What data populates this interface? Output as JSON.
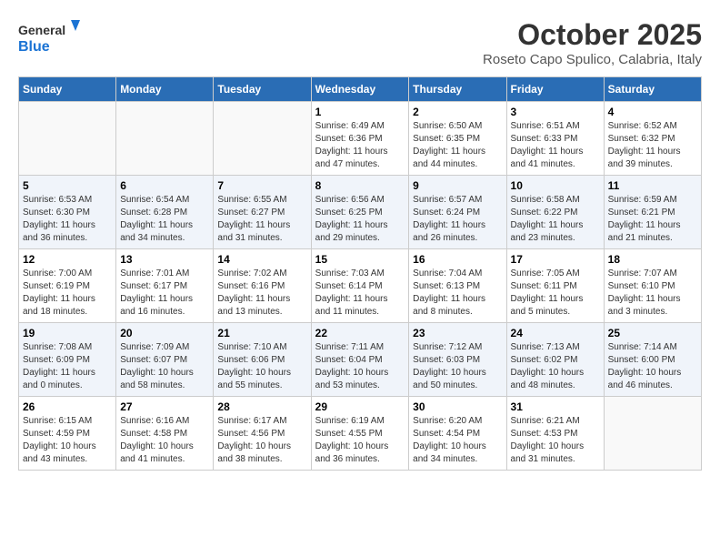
{
  "header": {
    "logo_line1": "General",
    "logo_line2": "Blue",
    "month": "October 2025",
    "location": "Roseto Capo Spulico, Calabria, Italy"
  },
  "days_of_week": [
    "Sunday",
    "Monday",
    "Tuesday",
    "Wednesday",
    "Thursday",
    "Friday",
    "Saturday"
  ],
  "weeks": [
    [
      {
        "day": "",
        "info": ""
      },
      {
        "day": "",
        "info": ""
      },
      {
        "day": "",
        "info": ""
      },
      {
        "day": "1",
        "info": "Sunrise: 6:49 AM\nSunset: 6:36 PM\nDaylight: 11 hours\nand 47 minutes."
      },
      {
        "day": "2",
        "info": "Sunrise: 6:50 AM\nSunset: 6:35 PM\nDaylight: 11 hours\nand 44 minutes."
      },
      {
        "day": "3",
        "info": "Sunrise: 6:51 AM\nSunset: 6:33 PM\nDaylight: 11 hours\nand 41 minutes."
      },
      {
        "day": "4",
        "info": "Sunrise: 6:52 AM\nSunset: 6:32 PM\nDaylight: 11 hours\nand 39 minutes."
      }
    ],
    [
      {
        "day": "5",
        "info": "Sunrise: 6:53 AM\nSunset: 6:30 PM\nDaylight: 11 hours\nand 36 minutes."
      },
      {
        "day": "6",
        "info": "Sunrise: 6:54 AM\nSunset: 6:28 PM\nDaylight: 11 hours\nand 34 minutes."
      },
      {
        "day": "7",
        "info": "Sunrise: 6:55 AM\nSunset: 6:27 PM\nDaylight: 11 hours\nand 31 minutes."
      },
      {
        "day": "8",
        "info": "Sunrise: 6:56 AM\nSunset: 6:25 PM\nDaylight: 11 hours\nand 29 minutes."
      },
      {
        "day": "9",
        "info": "Sunrise: 6:57 AM\nSunset: 6:24 PM\nDaylight: 11 hours\nand 26 minutes."
      },
      {
        "day": "10",
        "info": "Sunrise: 6:58 AM\nSunset: 6:22 PM\nDaylight: 11 hours\nand 23 minutes."
      },
      {
        "day": "11",
        "info": "Sunrise: 6:59 AM\nSunset: 6:21 PM\nDaylight: 11 hours\nand 21 minutes."
      }
    ],
    [
      {
        "day": "12",
        "info": "Sunrise: 7:00 AM\nSunset: 6:19 PM\nDaylight: 11 hours\nand 18 minutes."
      },
      {
        "day": "13",
        "info": "Sunrise: 7:01 AM\nSunset: 6:17 PM\nDaylight: 11 hours\nand 16 minutes."
      },
      {
        "day": "14",
        "info": "Sunrise: 7:02 AM\nSunset: 6:16 PM\nDaylight: 11 hours\nand 13 minutes."
      },
      {
        "day": "15",
        "info": "Sunrise: 7:03 AM\nSunset: 6:14 PM\nDaylight: 11 hours\nand 11 minutes."
      },
      {
        "day": "16",
        "info": "Sunrise: 7:04 AM\nSunset: 6:13 PM\nDaylight: 11 hours\nand 8 minutes."
      },
      {
        "day": "17",
        "info": "Sunrise: 7:05 AM\nSunset: 6:11 PM\nDaylight: 11 hours\nand 5 minutes."
      },
      {
        "day": "18",
        "info": "Sunrise: 7:07 AM\nSunset: 6:10 PM\nDaylight: 11 hours\nand 3 minutes."
      }
    ],
    [
      {
        "day": "19",
        "info": "Sunrise: 7:08 AM\nSunset: 6:09 PM\nDaylight: 11 hours\nand 0 minutes."
      },
      {
        "day": "20",
        "info": "Sunrise: 7:09 AM\nSunset: 6:07 PM\nDaylight: 10 hours\nand 58 minutes."
      },
      {
        "day": "21",
        "info": "Sunrise: 7:10 AM\nSunset: 6:06 PM\nDaylight: 10 hours\nand 55 minutes."
      },
      {
        "day": "22",
        "info": "Sunrise: 7:11 AM\nSunset: 6:04 PM\nDaylight: 10 hours\nand 53 minutes."
      },
      {
        "day": "23",
        "info": "Sunrise: 7:12 AM\nSunset: 6:03 PM\nDaylight: 10 hours\nand 50 minutes."
      },
      {
        "day": "24",
        "info": "Sunrise: 7:13 AM\nSunset: 6:02 PM\nDaylight: 10 hours\nand 48 minutes."
      },
      {
        "day": "25",
        "info": "Sunrise: 7:14 AM\nSunset: 6:00 PM\nDaylight: 10 hours\nand 46 minutes."
      }
    ],
    [
      {
        "day": "26",
        "info": "Sunrise: 6:15 AM\nSunset: 4:59 PM\nDaylight: 10 hours\nand 43 minutes."
      },
      {
        "day": "27",
        "info": "Sunrise: 6:16 AM\nSunset: 4:58 PM\nDaylight: 10 hours\nand 41 minutes."
      },
      {
        "day": "28",
        "info": "Sunrise: 6:17 AM\nSunset: 4:56 PM\nDaylight: 10 hours\nand 38 minutes."
      },
      {
        "day": "29",
        "info": "Sunrise: 6:19 AM\nSunset: 4:55 PM\nDaylight: 10 hours\nand 36 minutes."
      },
      {
        "day": "30",
        "info": "Sunrise: 6:20 AM\nSunset: 4:54 PM\nDaylight: 10 hours\nand 34 minutes."
      },
      {
        "day": "31",
        "info": "Sunrise: 6:21 AM\nSunset: 4:53 PM\nDaylight: 10 hours\nand 31 minutes."
      },
      {
        "day": "",
        "info": ""
      }
    ]
  ]
}
